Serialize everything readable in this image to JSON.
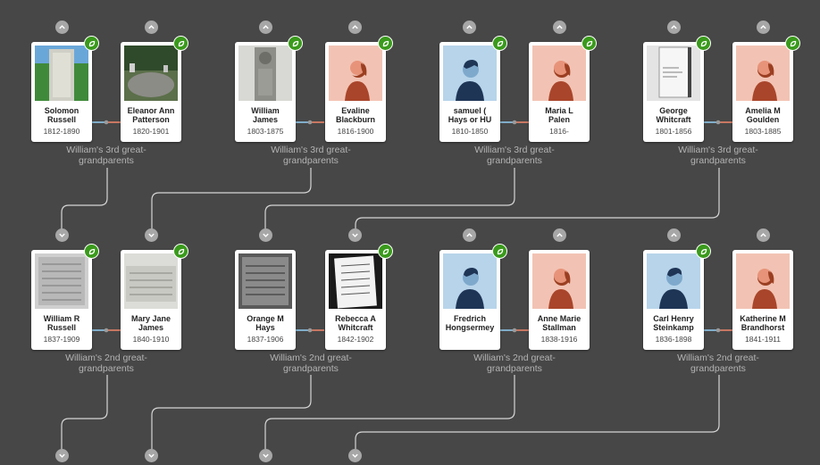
{
  "colors": {
    "background": "#474747",
    "line": "#d6d6d6",
    "hint_badge": "#3a9a1c",
    "expand_button": "#a7a7a7",
    "male_connector": "#8fc7ea",
    "female_connector": "#e8846a"
  },
  "icons": {
    "hint": "leaf-hint-icon",
    "expand_up": "chevron-up-icon",
    "expand_down": "chevron-down-icon"
  },
  "relationship_labels": {
    "great3": "William's 3rd great-\ngrandparents",
    "great2": "William's 2nd great-\ngrandparents"
  },
  "people": [
    {
      "id": "p1",
      "name": "Solomon\nRussell",
      "dates": "1812-1890",
      "photo": "gravestone"
    },
    {
      "id": "p2",
      "name": "Eleanor Ann\nPatterson",
      "dates": "1820-1901",
      "photo": "cemetery"
    },
    {
      "id": "p3",
      "name": "William\nJames",
      "dates": "1803-1875",
      "photo": "gravestone-worn"
    },
    {
      "id": "p4",
      "name": "Evaline\nBlackburn",
      "dates": "1816-1900",
      "photo": "female-silhouette"
    },
    {
      "id": "p5",
      "name": "samuel (\nHays or HU",
      "dates": "1810-1850",
      "photo": "male-silhouette"
    },
    {
      "id": "p6",
      "name": "Maria L\nPalen",
      "dates": "1816-",
      "photo": "female-silhouette"
    },
    {
      "id": "p7",
      "name": "George\nWhitcraft",
      "dates": "1801-1856",
      "photo": "document-page"
    },
    {
      "id": "p8",
      "name": "Amelia M\nGoulden",
      "dates": "1803-1885",
      "photo": "female-silhouette"
    },
    {
      "id": "p9",
      "name": "William R\nRussell",
      "dates": "1837-1909",
      "photo": "record-scan"
    },
    {
      "id": "p10",
      "name": "Mary Jane\nJames",
      "dates": "1840-1910",
      "photo": "record-handwritten"
    },
    {
      "id": "p11",
      "name": "Orange M\nHays",
      "dates": "1837-1906",
      "photo": "record-dark"
    },
    {
      "id": "p12",
      "name": "Rebecca A\nWhitcraft",
      "dates": "1842-1902",
      "photo": "death-certificate"
    },
    {
      "id": "p13",
      "name": "Fredrich\nHongsermey",
      "dates": "",
      "photo": "male-silhouette"
    },
    {
      "id": "p14",
      "name": "Anne Marie\nStallman",
      "dates": "1838-1916",
      "photo": "female-silhouette"
    },
    {
      "id": "p15",
      "name": "Carl Henry\nSteinkamp",
      "dates": "1836-1898",
      "photo": "male-silhouette"
    },
    {
      "id": "p16",
      "name": "Katherine M\nBrandhorst",
      "dates": "1841-1911",
      "photo": "female-silhouette"
    }
  ]
}
